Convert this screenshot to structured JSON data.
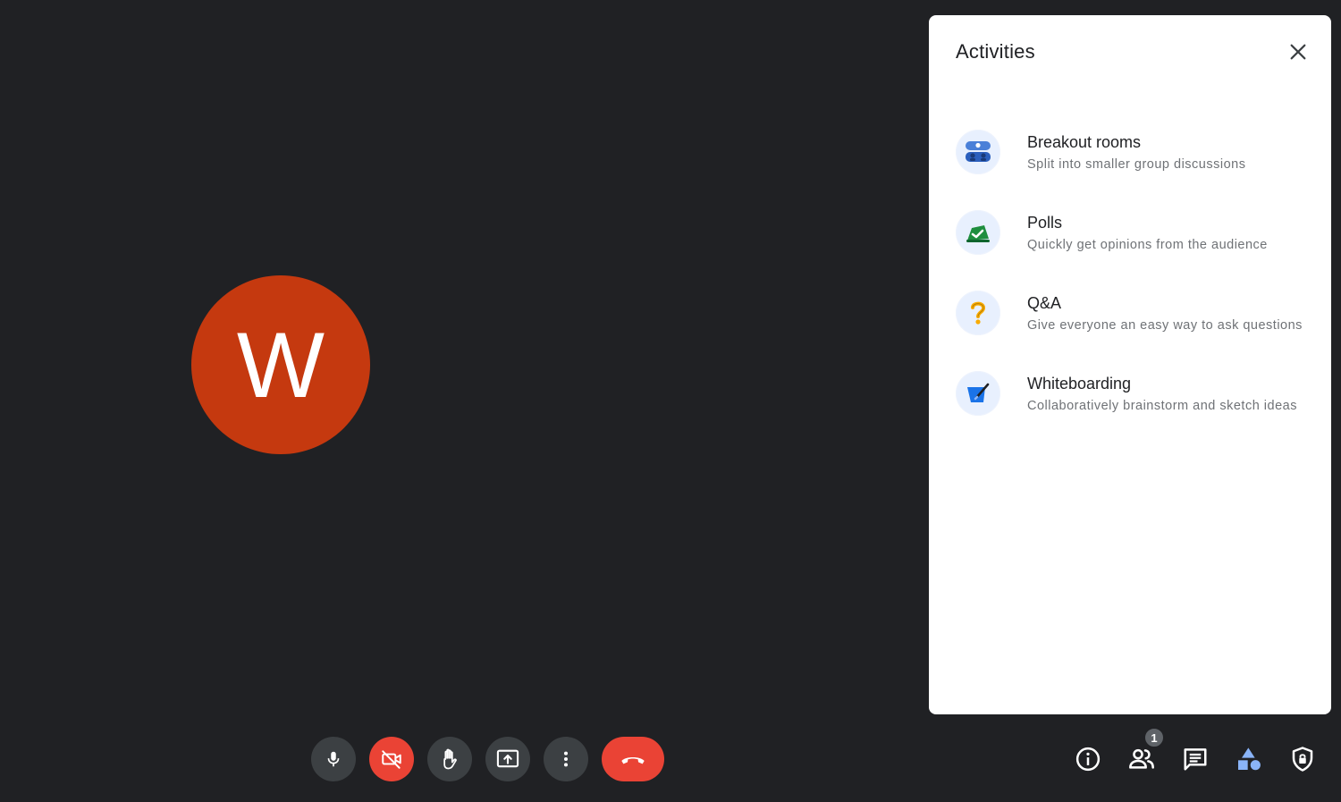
{
  "participant": {
    "initial": "W",
    "avatar_color": "#c5390f"
  },
  "panel": {
    "title": "Activities",
    "close_icon": "close-icon",
    "activities": [
      {
        "name": "Breakout rooms",
        "description": "Split into smaller group discussions",
        "icon": "breakout-rooms-icon"
      },
      {
        "name": "Polls",
        "description": "Quickly get opinions from the audience",
        "icon": "polls-icon"
      },
      {
        "name": "Q&A",
        "description": "Give everyone an easy way to ask questions",
        "icon": "qa-icon"
      },
      {
        "name": "Whiteboarding",
        "description": "Collaboratively brainstorm and sketch ideas",
        "icon": "whiteboard-icon"
      }
    ]
  },
  "controls": {
    "mic_icon": "microphone-icon",
    "camera_icon": "camera-off-icon",
    "hand_icon": "raise-hand-icon",
    "present_icon": "present-screen-icon",
    "more_icon": "more-options-icon",
    "end_icon": "end-call-icon",
    "danger_color": "#ea4335"
  },
  "side_controls": {
    "info_icon": "info-icon",
    "people_icon": "people-icon",
    "people_count": "1",
    "chat_icon": "chat-icon",
    "activities_icon": "activities-icon",
    "host_controls_icon": "host-controls-icon",
    "active_color": "#8ab4f8"
  }
}
